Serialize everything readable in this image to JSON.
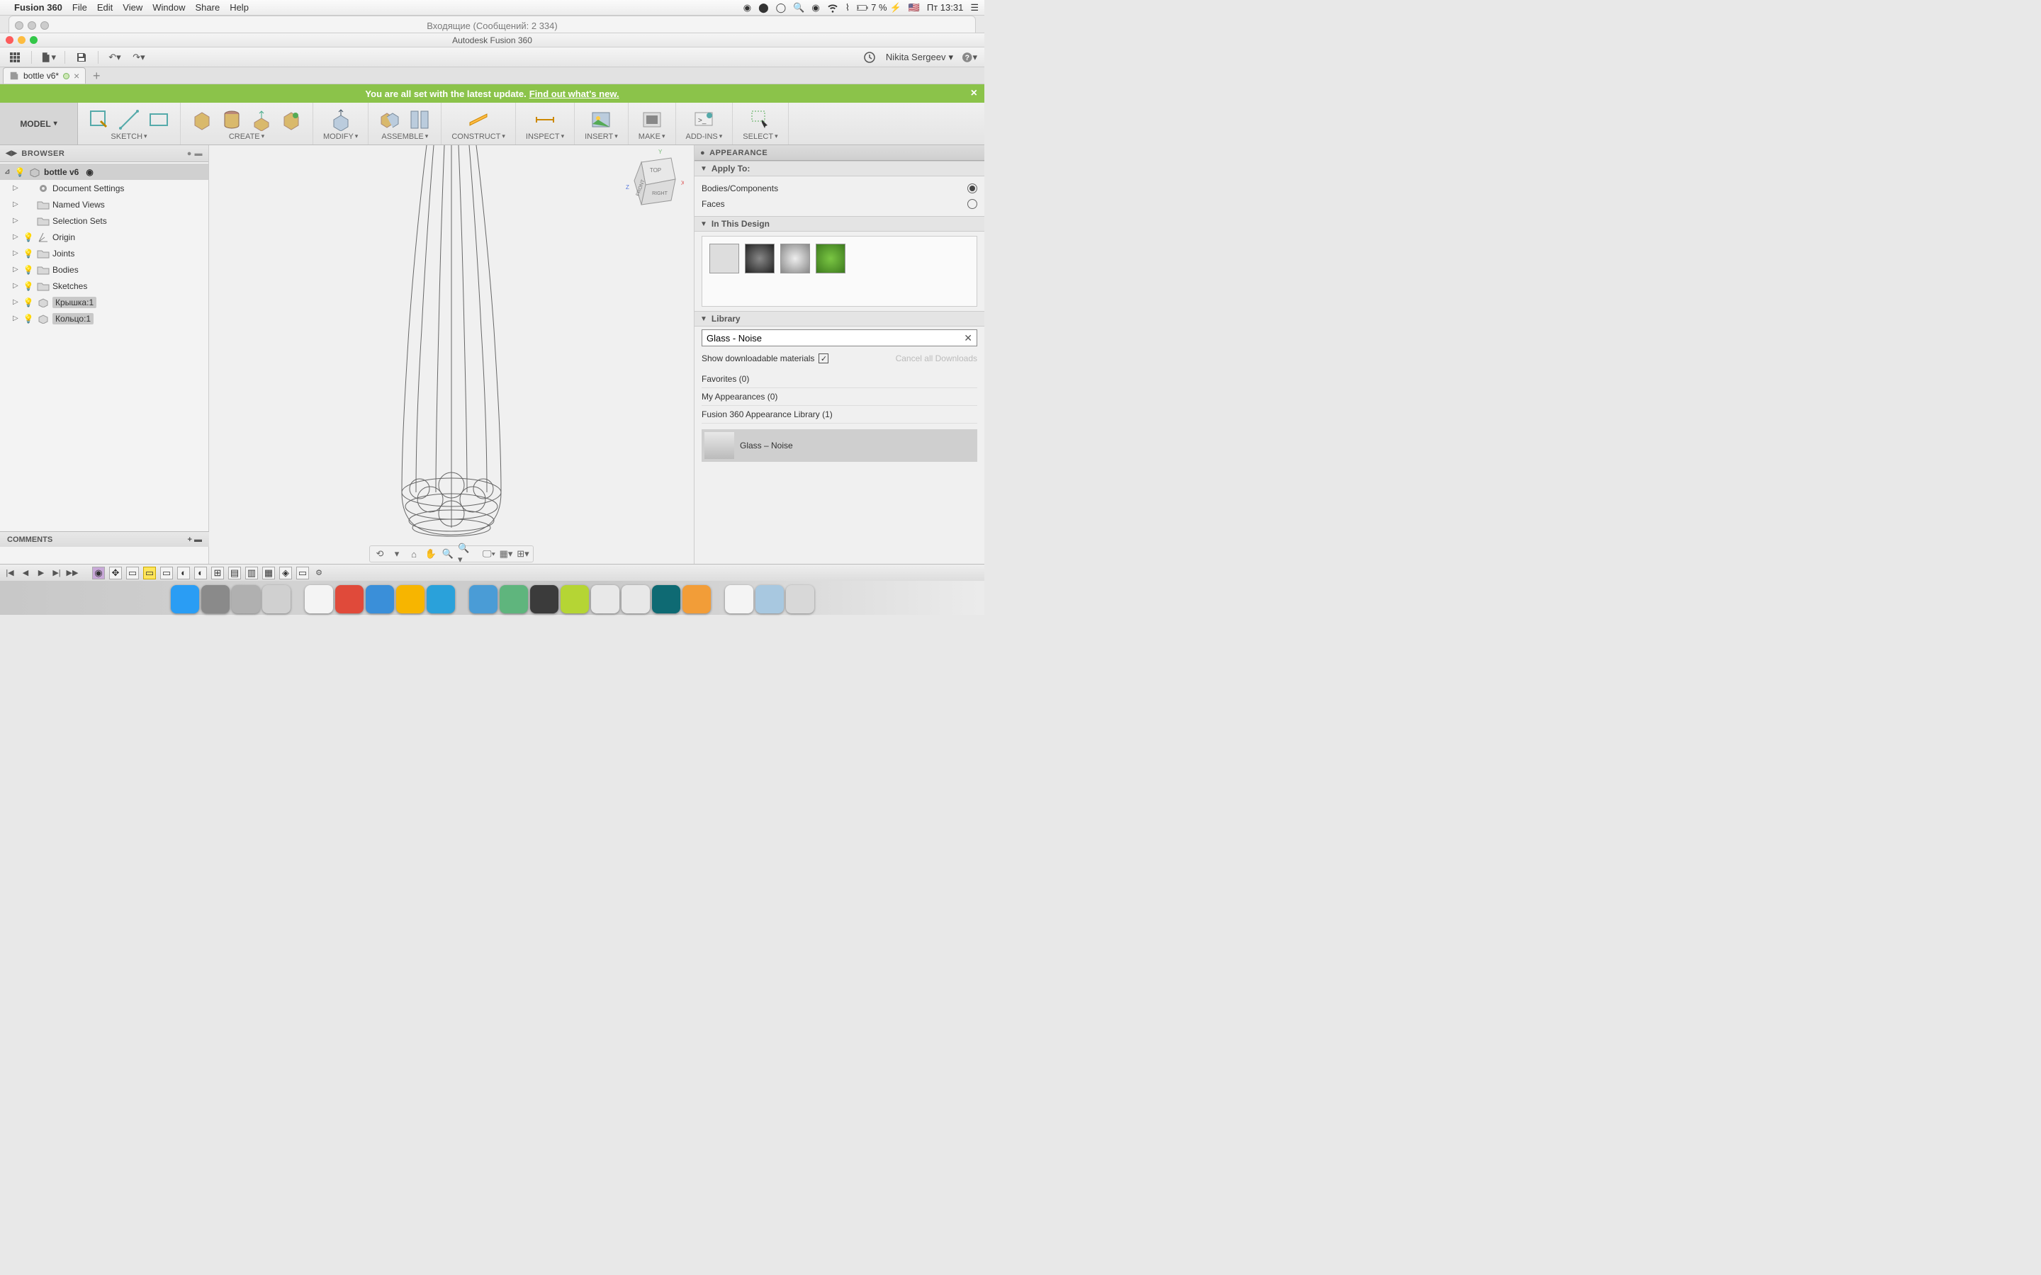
{
  "menubar": {
    "app": "Fusion 360",
    "items": [
      "File",
      "Edit",
      "View",
      "Window",
      "Share",
      "Help"
    ],
    "battery": "7 %",
    "date": "Пт 13:31"
  },
  "bgWindow": {
    "title": "Входящие (Сообщений: 2 334)"
  },
  "window": {
    "title": "Autodesk Fusion 360",
    "user": "Nikita Sergeev"
  },
  "tab": {
    "name": "bottle v6*"
  },
  "banner": {
    "text": "You are all set with the latest update.",
    "link": "Find out what's new."
  },
  "ribbon": {
    "workspace": "MODEL",
    "groups": [
      "SKETCH",
      "CREATE",
      "MODIFY",
      "ASSEMBLE",
      "CONSTRUCT",
      "INSPECT",
      "INSERT",
      "MAKE",
      "ADD-INS",
      "SELECT"
    ]
  },
  "browser": {
    "title": "BROWSER",
    "root": "bottle v6",
    "items": [
      {
        "label": "Document Settings",
        "icon": "gear"
      },
      {
        "label": "Named Views",
        "icon": "folder"
      },
      {
        "label": "Selection Sets",
        "icon": "folder"
      },
      {
        "label": "Origin",
        "icon": "origin",
        "bulb": true
      },
      {
        "label": "Joints",
        "icon": "folder",
        "bulb": true
      },
      {
        "label": "Bodies",
        "icon": "folder",
        "bulb": true
      },
      {
        "label": "Sketches",
        "icon": "folder",
        "bulb": true
      },
      {
        "label": "Крышка:1",
        "icon": "comp",
        "bulb": true,
        "highlight": true
      },
      {
        "label": "Кольцо:1",
        "icon": "comp",
        "bulb": true,
        "highlight": true
      }
    ]
  },
  "comments": {
    "title": "COMMENTS"
  },
  "appearance": {
    "title": "APPEARANCE",
    "applyTo": "Apply To:",
    "option1": "Bodies/Components",
    "option2": "Faces",
    "inDesign": "In This Design",
    "library": "Library",
    "searchValue": "Glass - Noise",
    "showDl": "Show downloadable materials",
    "cancelAll": "Cancel all Downloads",
    "favorites": "Favorites (0)",
    "myApp": "My Appearances (0)",
    "fusionLib": "Fusion 360 Appearance Library (1)",
    "resultName": "Glass – Noise"
  },
  "viewCube": {
    "top": "TOP",
    "front": "FRONT",
    "right": "RIGHT"
  },
  "dock": [
    {
      "name": "finder",
      "bg": "#2a9df4"
    },
    {
      "name": "launchpad",
      "bg": "#8a8a8a"
    },
    {
      "name": "safari-alt",
      "bg": "#b0b0b0"
    },
    {
      "name": "preview",
      "bg": "#d0d0d0"
    },
    {
      "name": "calendar",
      "bg": "#f4f4f4"
    },
    {
      "name": "todoist",
      "bg": "#e04a3a"
    },
    {
      "name": "safari",
      "bg": "#3a8fd9"
    },
    {
      "name": "sketch",
      "bg": "#f7b500"
    },
    {
      "name": "telegram",
      "bg": "#2aa1da"
    },
    {
      "name": "xcode",
      "bg": "#4a9cd6"
    },
    {
      "name": "atom",
      "bg": "#5fb57d"
    },
    {
      "name": "sublime",
      "bg": "#3b3b3b"
    },
    {
      "name": "muse",
      "bg": "#b5d534"
    },
    {
      "name": "zbrush",
      "bg": "#e8e8e8"
    },
    {
      "name": "redshift",
      "bg": "#e8e8e8"
    },
    {
      "name": "maya",
      "bg": "#0e6a73"
    },
    {
      "name": "fusion",
      "bg": "#f29d38"
    },
    {
      "name": "mulib",
      "bg": "#f4f4f4"
    },
    {
      "name": "folder",
      "bg": "#a8c8e0"
    },
    {
      "name": "trash",
      "bg": "#d8d8d8"
    }
  ]
}
